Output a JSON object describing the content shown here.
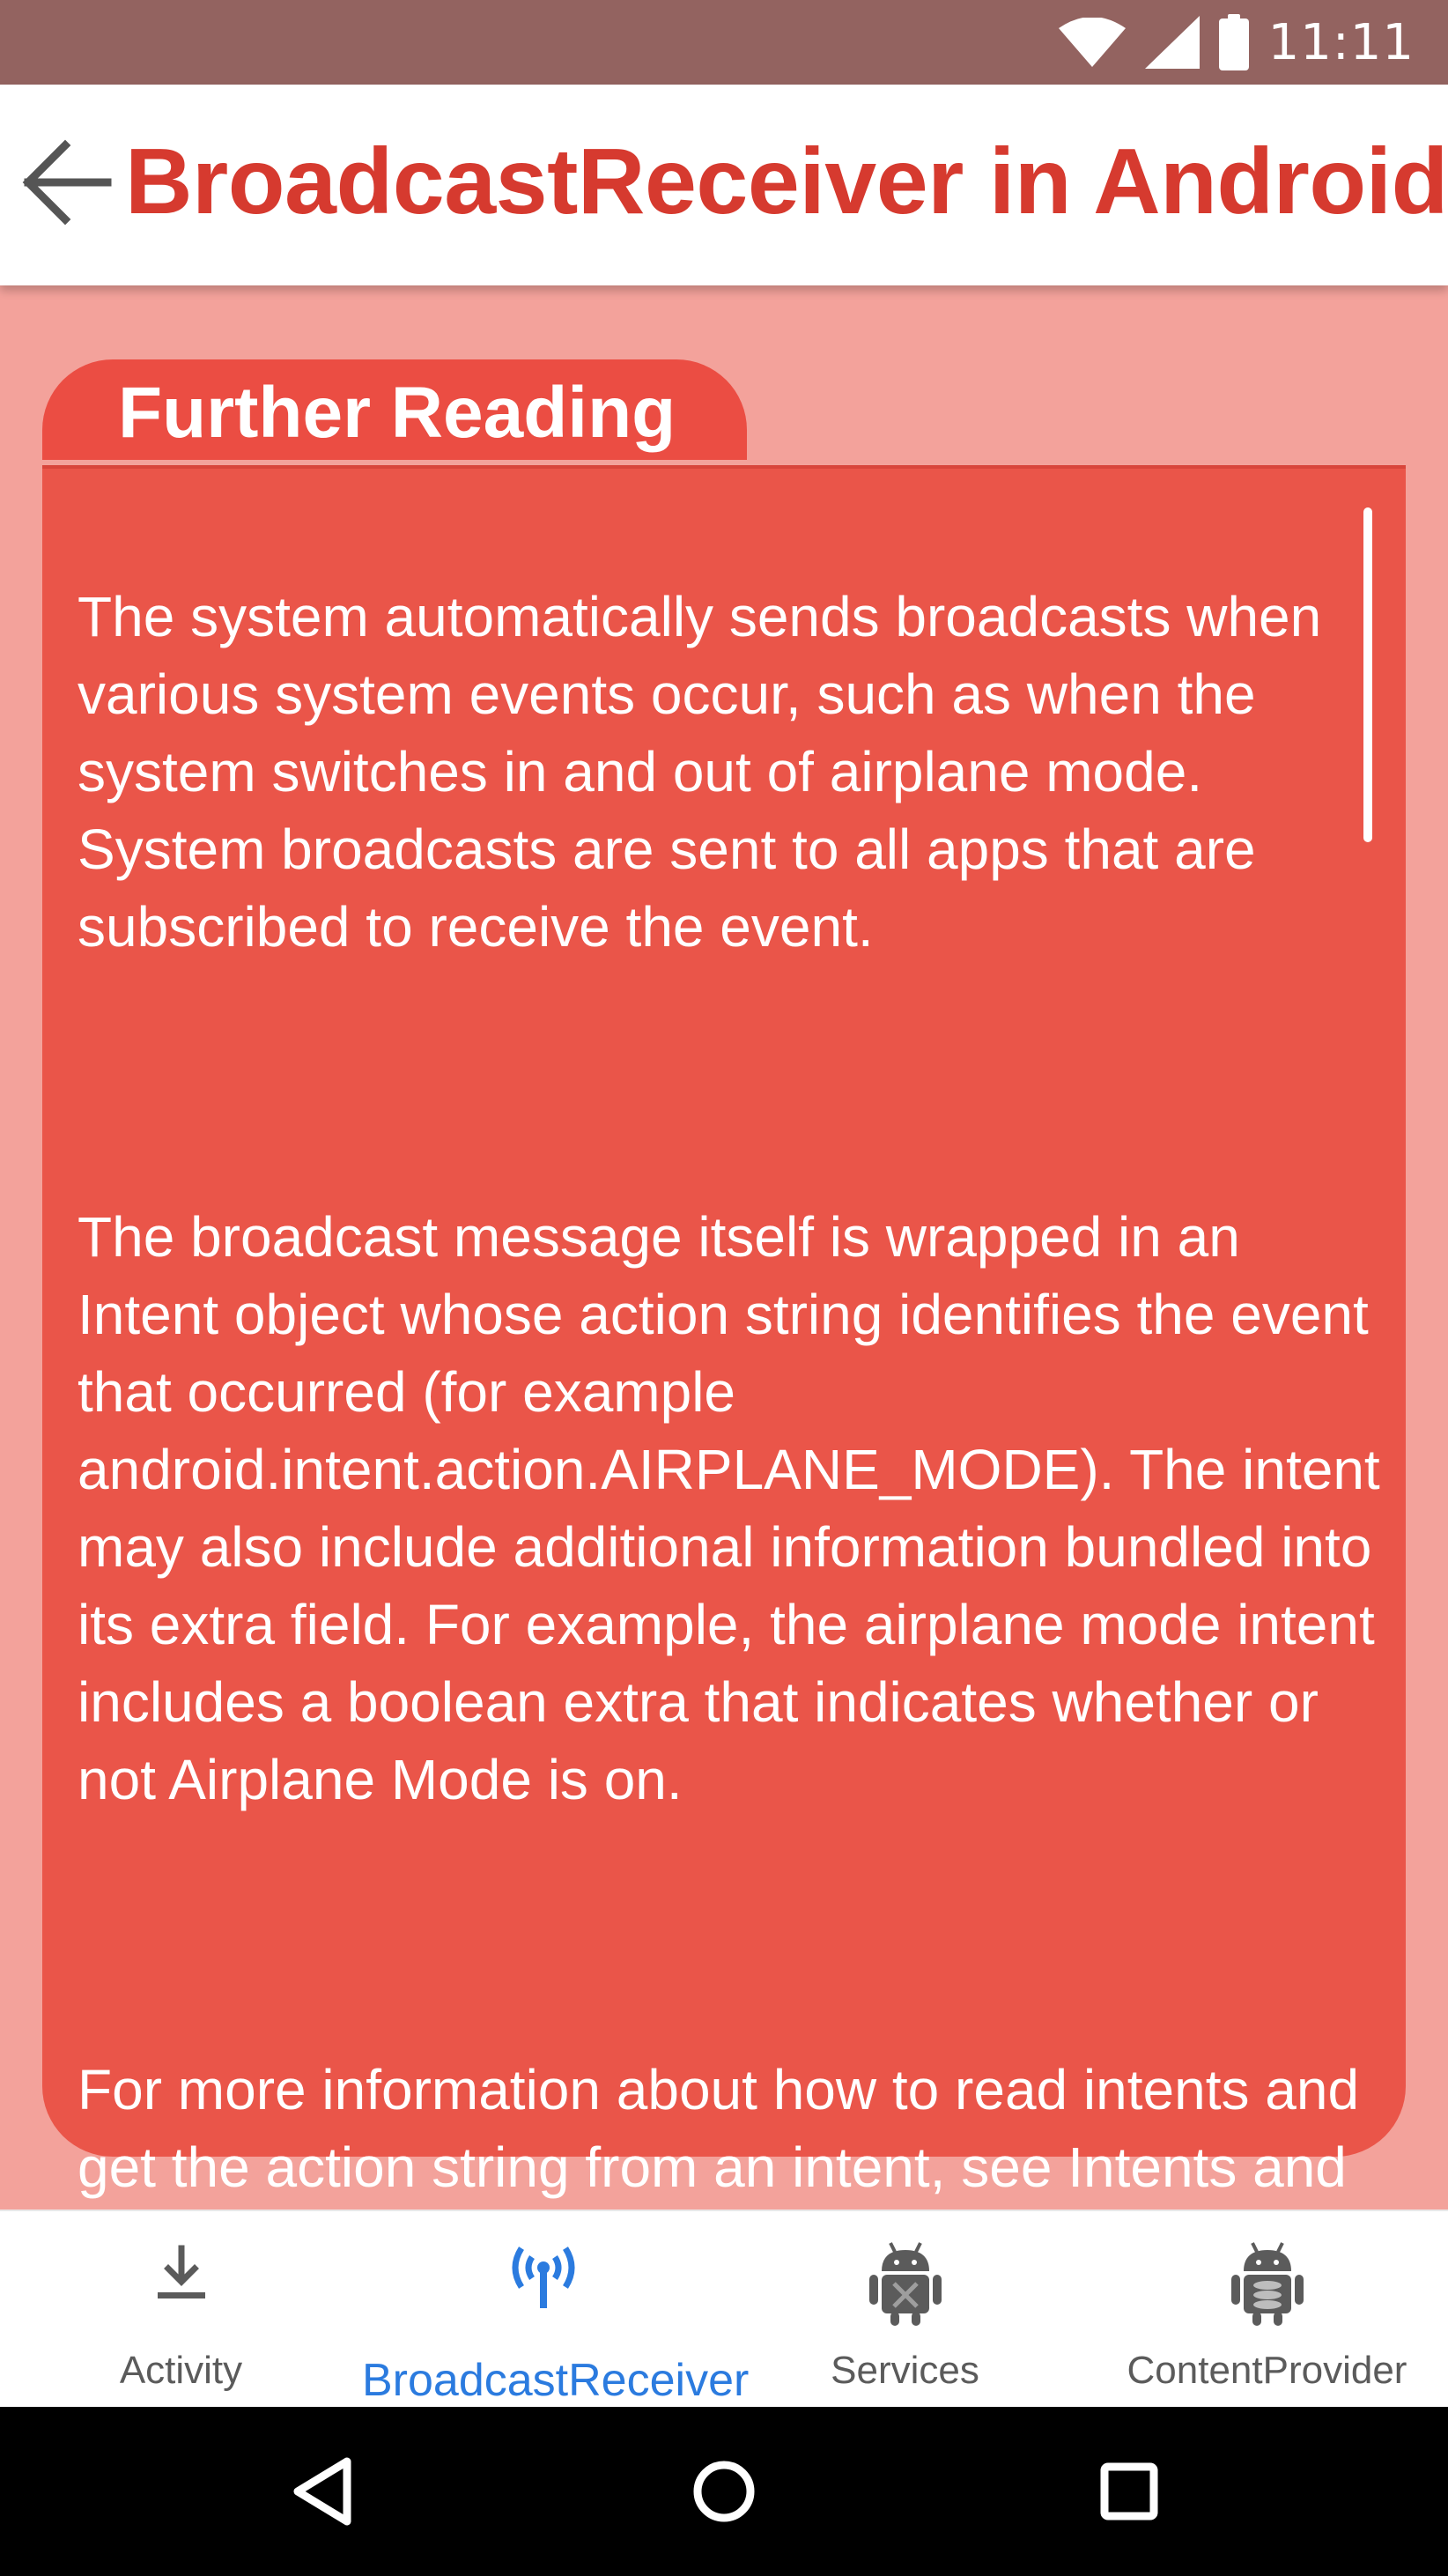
{
  "status_bar": {
    "time": "11:11",
    "icons": [
      "wifi-icon",
      "signal-icon",
      "battery-icon"
    ],
    "background": "#936360"
  },
  "app_bar": {
    "back_icon": "arrow-back-icon",
    "title": "BroadcastReceiver in Android",
    "title_color": "#d63a2f"
  },
  "section": {
    "heading": "Further Reading",
    "paragraphs": [
      "The system automatically sends broadcasts when various system events occur, such as when the system switches in and out of airplane mode. System broadcasts are sent to all apps that are subscribed to receive the event.",
      "The broadcast message itself is wrapped in an Intent object whose action string identifies the event that occurred (for example\nandroid.intent.action.AIRPLANE_MODE). The intent may also include additional information bundled into its extra field. For example, the airplane mode intent includes a boolean extra that indicates whether or not Airplane Mode is on.",
      "For more information about how to read intents and get the action string from an intent, see Intents and Intent Filters."
    ],
    "card_color": "#ea5549",
    "background": "#f3a29b"
  },
  "bottom_nav": {
    "items": [
      {
        "label": "Activity",
        "icon": "download-icon",
        "active": false
      },
      {
        "label": "BroadcastReceiver",
        "icon": "broadcast-antenna-icon",
        "active": true
      },
      {
        "label": "Services",
        "icon": "android-services-icon",
        "active": false
      },
      {
        "label": "ContentProvider",
        "icon": "android-database-icon",
        "active": false
      }
    ],
    "active_color": "#2b7bdf"
  },
  "system_nav": {
    "buttons": [
      "back-triangle-icon",
      "home-circle-icon",
      "recents-square-icon"
    ]
  }
}
